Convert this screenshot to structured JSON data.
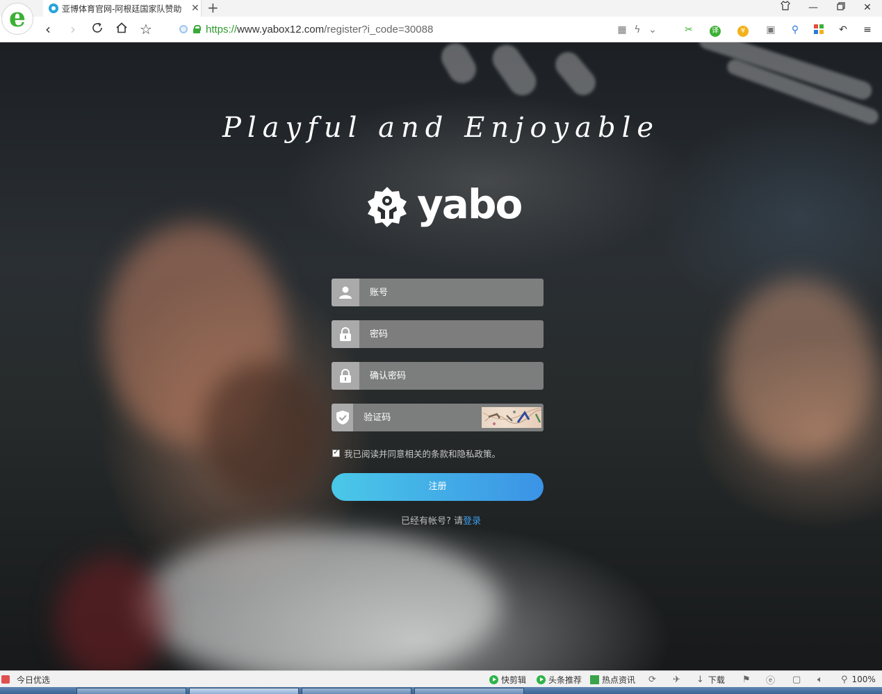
{
  "browser": {
    "tab_title": "亚博体育官网-阿根廷国家队赞助",
    "tab_close": "✕",
    "new_tab": "+",
    "url_scheme": "https://",
    "url_host": "www.yabox12.com",
    "url_path": "/register?i_code=30088",
    "window_controls": [
      "shirt-icon",
      "minimize-icon",
      "restore-icon",
      "close-icon"
    ]
  },
  "page": {
    "tagline": "Playful and Enjoyable",
    "logo_text": "yabo",
    "form": {
      "account_placeholder": "账号",
      "password_placeholder": "密码",
      "confirm_password_placeholder": "确认密码",
      "captcha_placeholder": "验证码",
      "agree_text": "我已阅读并同意相关的条款和隐私政策。",
      "agree_checked": true,
      "submit_label": "注册",
      "login_prompt": "已经有帐号? 请",
      "login_link": "登录"
    }
  },
  "statusbar": {
    "left_label": "今日优选",
    "items": [
      "快剪辑",
      "头条推荐",
      "热点资讯"
    ],
    "download_label": "下载",
    "zoom": "100%"
  },
  "colors": {
    "accent_start": "#4ac8e8",
    "accent_end": "#3b93e6",
    "link": "#3b9be8",
    "secure": "#2e9a2e"
  }
}
